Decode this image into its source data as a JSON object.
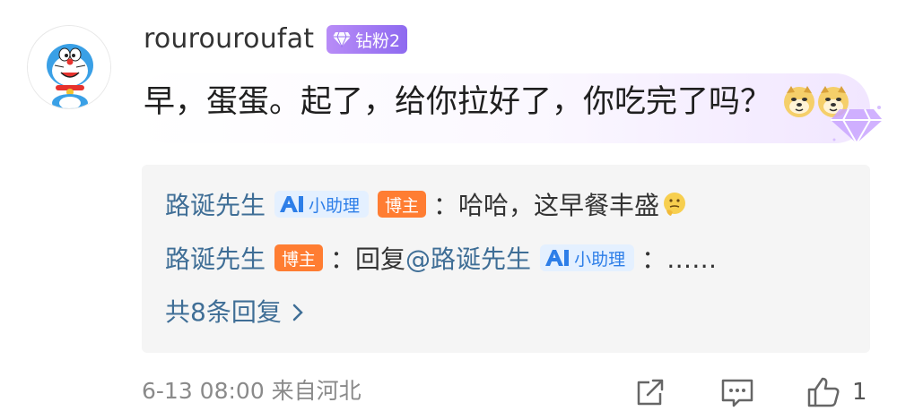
{
  "user": {
    "name": "rourouroufat",
    "badge": "钻粉2",
    "avatar": "doraemon-avatar"
  },
  "comment": {
    "text": "早，蛋蛋。起了，给你拉好了，你吃完了吗？",
    "emojis": [
      "doge-emoji",
      "doge-emoji"
    ]
  },
  "replies": [
    {
      "name": "路诞先生",
      "tags": [
        "小助理",
        "博主"
      ],
      "text": "：哈哈，这早餐丰盛",
      "emoji": "thinking-emoji"
    },
    {
      "name": "路诞先生",
      "tags": [
        "博主"
      ],
      "text_prefix": "：回复",
      "mention": "@路诞先生",
      "mention_tag": "小助理",
      "text_suffix": "：……"
    }
  ],
  "more_replies": "共8条回复",
  "meta": {
    "time_location": "6-13 08:00 来自河北"
  },
  "actions": {
    "like_count": "1"
  },
  "colors": {
    "link": "#3f6e96",
    "owner_tag": "#ff7d32",
    "assistant_tag": "#2d7ee8",
    "badge_purple": "#9a73f2"
  }
}
